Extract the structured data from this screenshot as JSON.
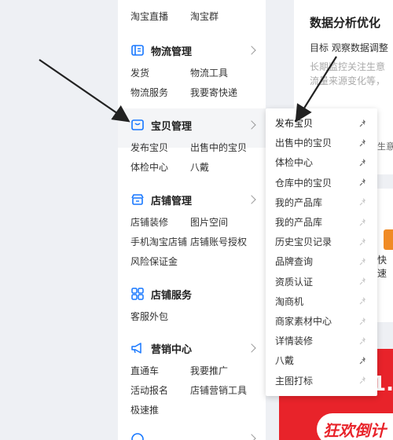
{
  "colors": {
    "accent": "#1677ff",
    "banner_red": "#e8232a",
    "orange": "#f08a24"
  },
  "menu": {
    "top_partial": {
      "links": [
        "淘宝直播",
        "淘宝群"
      ]
    },
    "logistics": {
      "title": "物流管理",
      "icon": "truck-icon",
      "links": [
        "发货",
        "物流工具",
        "物流服务",
        "我要寄快递"
      ]
    },
    "goods": {
      "title": "宝贝管理",
      "icon": "box-icon",
      "links": [
        "发布宝贝",
        "出售中的宝贝",
        "体检中心",
        "八戴"
      ]
    },
    "shop": {
      "title": "店铺管理",
      "icon": "shop-icon",
      "links": [
        "店铺装修",
        "图片空间",
        "手机淘宝店铺",
        "店铺账号授权",
        "风险保证金"
      ]
    },
    "service": {
      "title": "店铺服务",
      "icon": "grid-icon",
      "links": [
        "客服外包"
      ]
    },
    "marketing": {
      "title": "营销中心",
      "icon": "megaphone-icon",
      "links": [
        "直通车",
        "我要推广",
        "活动报名",
        "店铺营销工具",
        "极速推"
      ]
    }
  },
  "flyout": {
    "items": [
      {
        "label": "发布宝贝",
        "pinned": true
      },
      {
        "label": "出售中的宝贝",
        "pinned": true
      },
      {
        "label": "体检中心",
        "pinned": true
      },
      {
        "label": "仓库中的宝贝",
        "pinned": true
      },
      {
        "label": "我的产品库",
        "pinned": false
      },
      {
        "label": "我的产品库",
        "pinned": false
      },
      {
        "label": "历史宝贝记录",
        "pinned": false
      },
      {
        "label": "品牌查询",
        "pinned": false
      },
      {
        "label": "资质认证",
        "pinned": false
      },
      {
        "label": "淘商机",
        "pinned": false
      },
      {
        "label": "商家素材中心",
        "pinned": false
      },
      {
        "label": "详情装修",
        "pinned": false
      },
      {
        "label": "八戴",
        "pinned": true
      },
      {
        "label": "主图打标",
        "pinned": false
      }
    ]
  },
  "right": {
    "title": "数据分析优化",
    "subtitle": "目标 观察数据调整",
    "note_line1": "长期监控关注生意",
    "note_line2": "流量来源变化等，",
    "mid_text": "生意",
    "kuai": "快速",
    "banner_text": "1.",
    "banner_pill": "狂欢倒计"
  }
}
